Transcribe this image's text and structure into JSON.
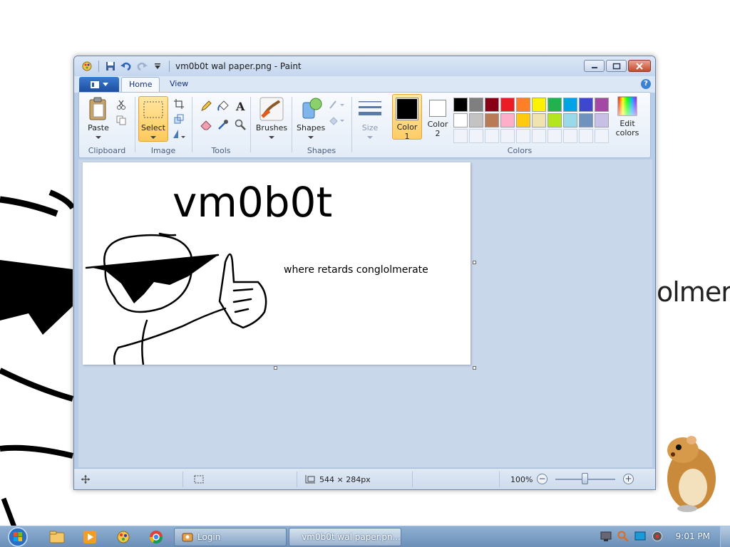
{
  "window": {
    "title": "vm0b0t wal paper.png - Paint",
    "tabs": [
      "Home",
      "View"
    ],
    "active_tab": "Home"
  },
  "ribbon": {
    "clipboard": {
      "label": "Clipboard",
      "paste": "Paste"
    },
    "image": {
      "label": "Image",
      "select": "Select"
    },
    "tools": {
      "label": "Tools"
    },
    "brushes": "Brushes",
    "shapes": {
      "label": "Shapes",
      "button": "Shapes"
    },
    "size": "Size",
    "colors": {
      "label": "Colors",
      "color1": [
        "Color",
        "1"
      ],
      "color2": [
        "Color",
        "2"
      ],
      "color1_value": "#000000",
      "color2_value": "#ffffff",
      "edit_colors": [
        "Edit",
        "colors"
      ],
      "palette": [
        "#000000",
        "#7f7f7f",
        "#880015",
        "#ed1c24",
        "#ff7f27",
        "#fff200",
        "#22b14c",
        "#00a2e8",
        "#3f48cc",
        "#a349a4",
        "#ffffff",
        "#c3c3c3",
        "#b97a57",
        "#ffaec9",
        "#ffc90e",
        "#efe4b0",
        "#b5e61d",
        "#99d9ea",
        "#7092be",
        "#c8bfe7",
        "",
        "",
        "",
        "",
        "",
        "",
        "",
        "",
        "",
        ""
      ]
    }
  },
  "canvas": {
    "heading": "vm0b0t",
    "caption": "where retards conglolmerate"
  },
  "status": {
    "image_size": "544 × 284px",
    "zoom": "100%"
  },
  "taskbar": {
    "tasks": [
      "Login",
      "vm0b0t wal paper.pn..."
    ],
    "clock": "9:01 PM"
  },
  "wallpaper": {
    "fragment": "olmera"
  }
}
